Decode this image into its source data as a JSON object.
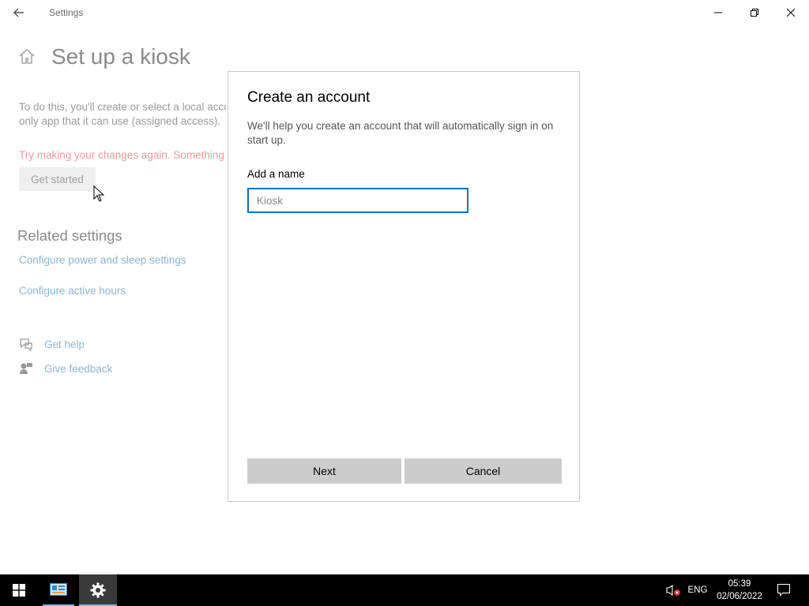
{
  "window": {
    "title": "Settings"
  },
  "page": {
    "title": "Set up a kiosk",
    "description_line1": "To do this, you'll create or select a local account",
    "description_line2": "only app that it can use (assigned access).",
    "error_text": "Try making your changes again. Something went wrong.",
    "get_started_label": "Get started"
  },
  "related": {
    "heading": "Related settings",
    "links": [
      "Configure power and sleep settings",
      "Configure active hours"
    ]
  },
  "support": {
    "get_help": "Get help",
    "give_feedback": "Give feedback"
  },
  "dialog": {
    "title": "Create an account",
    "subtitle": "We'll help you create an account that will automatically sign in on start up.",
    "name_label": "Add a name",
    "name_value": "",
    "name_placeholder": "Kiosk",
    "next_label": "Next",
    "cancel_label": "Cancel",
    "focus_color": "#0f6fb8"
  },
  "taskbar": {
    "language": "ENG",
    "time": "05:39",
    "date": "02/06/2022",
    "icons": [
      "windows-start-icon",
      "control-panel-icon",
      "settings-gear-icon",
      "volume-muted-icon",
      "action-center-icon"
    ]
  },
  "colors": {
    "accent": "#0f6fb8",
    "link": "#8fb4d4",
    "error": "#e79b9b",
    "taskbar": "#000000"
  }
}
